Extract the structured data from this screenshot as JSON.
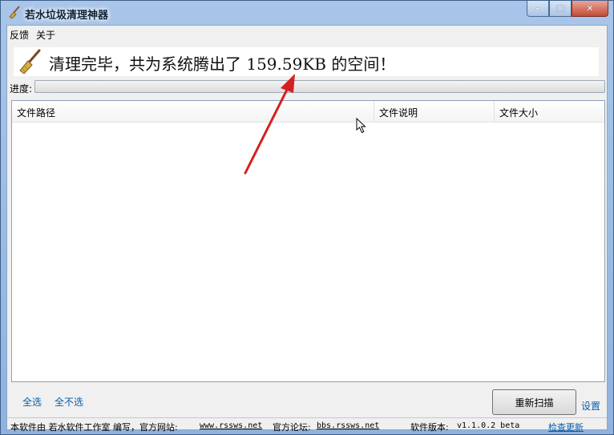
{
  "window": {
    "title": "若水垃圾清理神器",
    "buttons": {
      "minimize": "–",
      "maximize": "□",
      "close": "✕"
    }
  },
  "menu": {
    "items": [
      "反馈",
      "关于"
    ]
  },
  "banner": {
    "message": "清理完毕，共为系统腾出了 159.59KB 的空间！"
  },
  "progress": {
    "label": "进度:",
    "value": 0
  },
  "table": {
    "columns": [
      "文件路径",
      "文件说明",
      "文件大小"
    ],
    "rows": []
  },
  "actions": {
    "select_all": "全选",
    "select_none": "全不选",
    "rescan": "重新扫描",
    "settings": "设置"
  },
  "status": {
    "made_by": "本软件由 若水软件工作室 编写，官方网站:",
    "website": "www.rssws.net",
    "forum_label": "官方论坛:",
    "forum": "bbs.rssws.net",
    "version_label": "软件版本:",
    "version": "v1.1.0.2 beta",
    "check_update": "检查更新"
  },
  "colors": {
    "link": "#0b5ea8",
    "annotation_arrow": "#d42020"
  }
}
